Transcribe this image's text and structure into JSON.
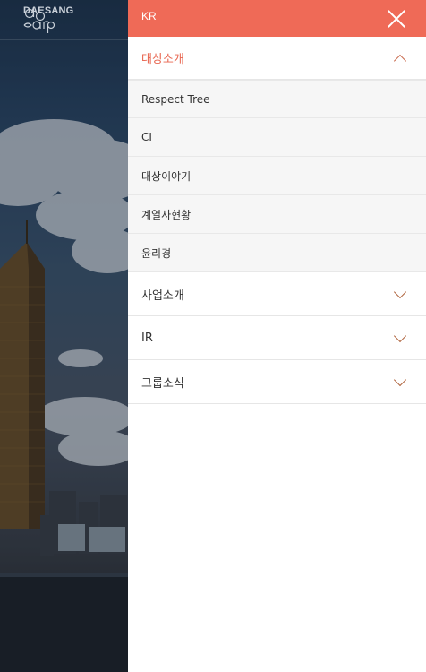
{
  "brand": {
    "logo_text": "DAESANG",
    "logo_mark_name": "daesang-logo-mark"
  },
  "drawer": {
    "language": "KR",
    "close_icon": "close-icon",
    "header_color": "#ef6a57",
    "active_color": "#e8654f",
    "menu": [
      {
        "label": "대상소개",
        "expanded": true,
        "icon": "chevron-up-icon",
        "children": [
          {
            "label": "Respect Tree"
          },
          {
            "label": "CI"
          },
          {
            "label": "대상이야기"
          },
          {
            "label": "계열사현황"
          },
          {
            "label": "윤리경"
          }
        ]
      },
      {
        "label": "사업소개",
        "expanded": false,
        "icon": "chevron-down-icon"
      },
      {
        "label": "IR",
        "expanded": false,
        "icon": "chevron-down-icon"
      },
      {
        "label": "그룹소식",
        "expanded": false,
        "icon": "chevron-down-icon"
      }
    ]
  }
}
